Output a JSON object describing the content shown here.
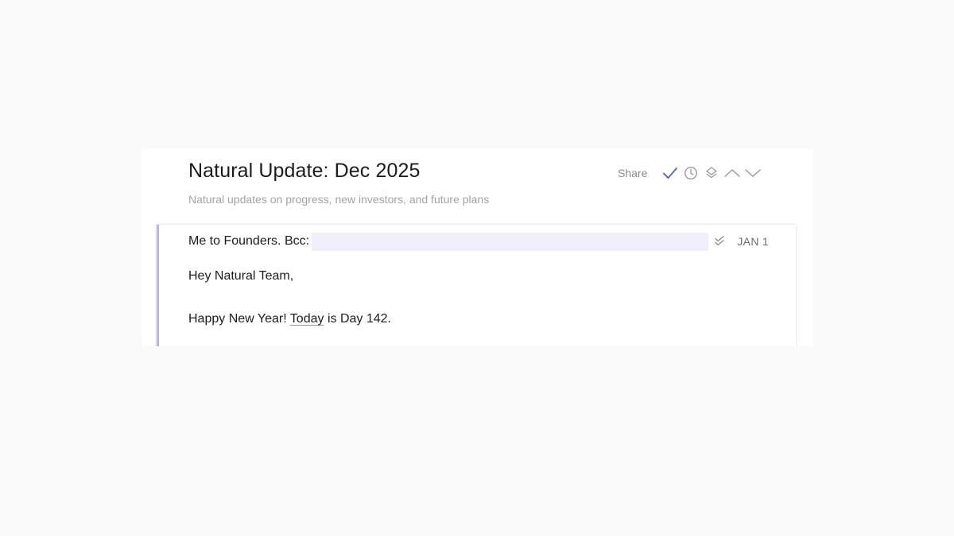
{
  "document": {
    "title": "Natural Update: Dec 2025",
    "subtitle": "Natural updates on progress, new investors, and future plans"
  },
  "toolbar": {
    "share_label": "Share",
    "icons": [
      "check-icon",
      "clock-icon",
      "layers-icon",
      "chevron-up-icon",
      "chevron-down-icon"
    ]
  },
  "email": {
    "from_label": "Me to Founders. Bcc:",
    "bcc_value": "",
    "date": "JAN 1",
    "greeting": "Hey Natural Team,",
    "line_part1": "Happy New Year! ",
    "line_link": "Today",
    "line_part2": " is Day 142."
  },
  "colors": {
    "accent_bar": "#b5b6f0",
    "bcc_highlight": "#efeffc",
    "check_icon": "#5b6fb5"
  }
}
